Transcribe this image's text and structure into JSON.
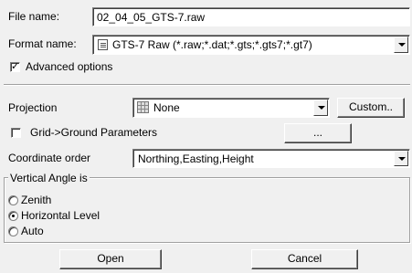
{
  "file_name": {
    "label": "File name:",
    "value": "02_04_05_GTS-7.raw"
  },
  "format_name": {
    "label": "Format name:",
    "value": "GTS-7 Raw (*.raw;*.dat;*.gts;*.gts7;*.gt7)",
    "icon": "file-icon"
  },
  "advanced_options": {
    "label": "Advanced options",
    "checked": true
  },
  "projection": {
    "label": "Projection",
    "value": "None",
    "icon": "grid-icon",
    "custom_button": "Custom.."
  },
  "grid_ground": {
    "label": "Grid->Ground Parameters",
    "checked": false,
    "button": "..."
  },
  "coordinate_order": {
    "label": "Coordinate order",
    "value": "Northing,Easting,Height"
  },
  "vertical_angle": {
    "legend": "Vertical Angle is",
    "options": [
      {
        "label": "Zenith",
        "selected": false
      },
      {
        "label": "Horizontal Level",
        "selected": true
      },
      {
        "label": "Auto",
        "selected": false
      }
    ]
  },
  "buttons": {
    "open": "Open",
    "cancel": "Cancel"
  }
}
